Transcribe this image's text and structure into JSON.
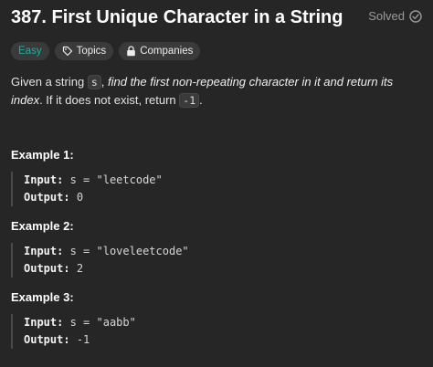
{
  "header": {
    "title": "387. First Unique Character in a String",
    "status": "Solved"
  },
  "tags": {
    "difficulty": "Easy",
    "topics": "Topics",
    "companies": "Companies"
  },
  "description": {
    "part1": "Given a string ",
    "code1": "s",
    "part2": ", ",
    "emphasis": "find the first non-repeating character in it and return its index",
    "part3": ". If it does not exist, return ",
    "code2": "-1",
    "part4": "."
  },
  "examples": [
    {
      "title": "Example 1:",
      "input_label": "Input:",
      "input_value": "s = \"leetcode\"",
      "output_label": "Output:",
      "output_value": "0"
    },
    {
      "title": "Example 2:",
      "input_label": "Input:",
      "input_value": "s = \"loveleetcode\"",
      "output_label": "Output:",
      "output_value": "2"
    },
    {
      "title": "Example 3:",
      "input_label": "Input:",
      "input_value": "s = \"aabb\"",
      "output_label": "Output:",
      "output_value": "-1"
    }
  ],
  "icons": {
    "solved": "check-circle-icon",
    "topics": "tag-icon",
    "companies": "lock-icon"
  },
  "colors": {
    "easy": "#1bb0a4",
    "background": "#262626"
  }
}
